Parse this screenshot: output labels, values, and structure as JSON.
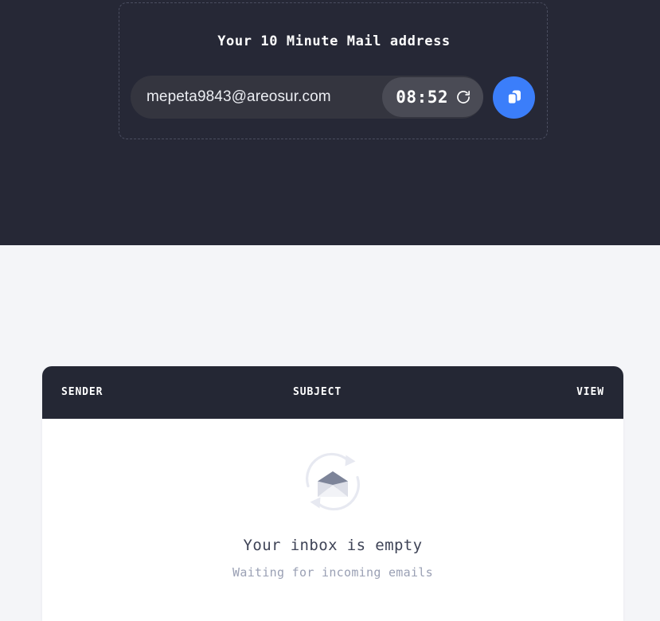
{
  "colors": {
    "hero_background": "#262836",
    "page_background": "#f4f5f8",
    "card_header_background": "#242734",
    "accent_blue": "#3b7efa",
    "email_pill_background": "#34353f",
    "timer_pill_background": "#4a4b55",
    "empty_title_color": "#3e4356",
    "empty_subtitle_color": "#9aa0b4"
  },
  "hero": {
    "title": "Your 10 Minute Mail address",
    "email_address": "mepeta9843@areosur.com",
    "timer": "08:52",
    "refresh_icon": "refresh-icon",
    "copy_icon": "copy-icon"
  },
  "inbox": {
    "columns": [
      {
        "key": "sender",
        "label": "SENDER"
      },
      {
        "key": "subject",
        "label": "SUBJECT"
      },
      {
        "key": "view",
        "label": "VIEW"
      }
    ],
    "rows": [],
    "empty_state": {
      "icon": "envelope-sync-icon",
      "title": "Your inbox is empty",
      "subtitle": "Waiting for incoming emails"
    }
  }
}
